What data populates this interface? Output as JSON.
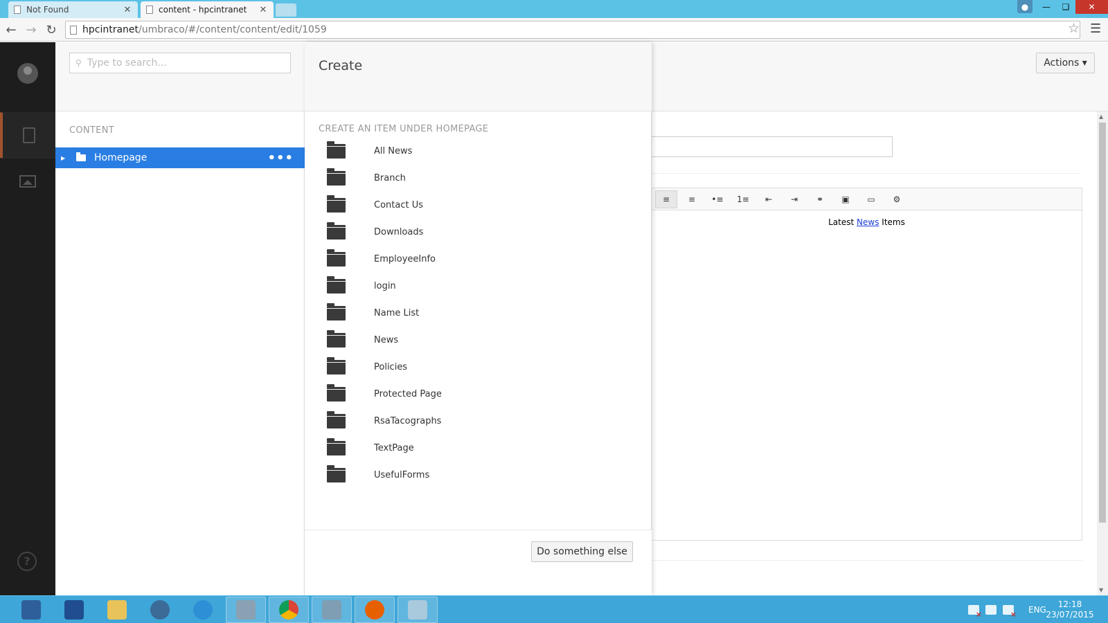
{
  "browser": {
    "tabs": [
      {
        "title": "Not Found",
        "active": false
      },
      {
        "title": "content - hpcintranet",
        "active": true
      }
    ],
    "url_host": "hpcintranet",
    "url_path": "/umbraco/#/content/content/edit/1059"
  },
  "tree": {
    "search_placeholder": "Type to search...",
    "section_title": "CONTENT",
    "root_node": "Homepage"
  },
  "dialog": {
    "title": "Create",
    "subtitle": "CREATE AN ITEM UNDER HOMEPAGE",
    "items": [
      "All News",
      "Branch",
      "Contact Us",
      "Downloads",
      "EmployeeInfo",
      "login",
      "Name List",
      "News",
      "Policies",
      "Protected Page",
      "RsaTacographs",
      "TextPage",
      "UsefulForms"
    ],
    "footer_button": "Do something else"
  },
  "editor": {
    "actions_label": "Actions ▾",
    "body_before": "Latest ",
    "body_link": "News",
    "body_after": " Items"
  },
  "taskbar": {
    "language": "ENG",
    "time": "12:18",
    "date": "23/07/2015"
  },
  "colors": {
    "titlebar": "#5bc2e6",
    "tree_selected": "#2a7ee3",
    "appbar": "#1d1d1d",
    "taskbar": "#3ea6d8"
  }
}
